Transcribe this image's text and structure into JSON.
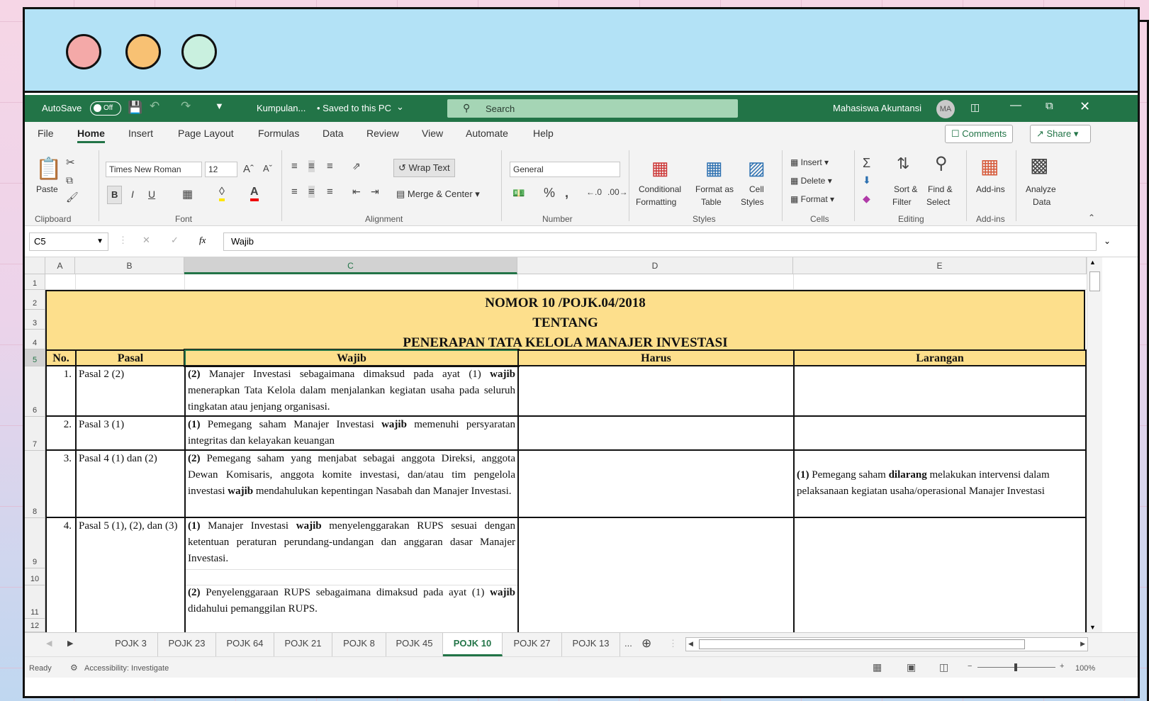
{
  "window": {
    "autosave_label": "AutoSave",
    "autosave_state": "Off",
    "doc_title": "Kumpulan...",
    "save_status": "• Saved to this PC",
    "search_placeholder": "Search",
    "user_name": "Mahasiswa Akuntansi",
    "user_initials": "MA"
  },
  "menu": [
    "File",
    "Home",
    "Insert",
    "Page Layout",
    "Formulas",
    "Data",
    "Review",
    "View",
    "Automate",
    "Help"
  ],
  "menu_active": "Home",
  "comments_label": "Comments",
  "share_label": "Share",
  "ribbon": {
    "paste": "Paste",
    "clipboard": "Clipboard",
    "font_name": "Times New Roman",
    "font_size": "12",
    "font": "Font",
    "wrap_text": "Wrap Text",
    "merge_center": "Merge & Center",
    "alignment": "Alignment",
    "number_format": "General",
    "number": "Number",
    "conditional_1": "Conditional",
    "conditional_2": "Formatting",
    "format_table_1": "Format as",
    "format_table_2": "Table",
    "cell_styles_1": "Cell",
    "cell_styles_2": "Styles",
    "styles": "Styles",
    "insert": "Insert",
    "delete": "Delete",
    "format": "Format",
    "cells": "Cells",
    "sort_1": "Sort &",
    "sort_2": "Filter",
    "find_1": "Find &",
    "find_2": "Select",
    "editing": "Editing",
    "addins": "Add-ins",
    "analyze_1": "Analyze",
    "analyze_2": "Data",
    "addins_group": "Add-ins"
  },
  "formula_bar": {
    "name_box": "C5",
    "fx": "fx",
    "value": "Wajib"
  },
  "columns": [
    "A",
    "B",
    "C",
    "D",
    "E"
  ],
  "rows": [
    "1",
    "2",
    "3",
    "4",
    "5",
    "6",
    "7",
    "8",
    "9",
    "10",
    "11",
    "12"
  ],
  "sheet": {
    "title_line1": "NOMOR 10 /POJK.04/2018",
    "title_line2": "TENTANG",
    "title_line3": "PENERAPAN TATA KELOLA MANAJER INVESTASI",
    "headers": [
      "No.",
      "Pasal",
      "Wajib",
      "Harus",
      "Larangan"
    ],
    "r1": {
      "no": "1.",
      "pasal": "Pasal 2 (2)",
      "wajib_pre": "(2)",
      "wajib_a": " Manajer Investasi sebagaimana dimaksud pada ayat (1) ",
      "wajib_kw": "wajib",
      "wajib_b": " menerapkan Tata Kelola dalam menjalankan kegiatan usaha pada seluruh tingkatan atau jenjang organisasi."
    },
    "r2": {
      "no": "2.",
      "pasal": "Pasal 3 (1)",
      "wajib_pre": "(1)",
      "wajib_a": " Pemegang saham Manajer Investasi ",
      "wajib_kw": "wajib",
      "wajib_b": " memenuhi persyaratan integritas dan kelayakan keuangan"
    },
    "r3": {
      "no": "3.",
      "pasal": "Pasal 4 (1) dan (2)",
      "wajib_pre": "(2)",
      "wajib_a": " Pemegang saham yang menjabat sebagai anggota Direksi, anggota Dewan Komisaris, anggota komite investasi, dan/atau tim pengelola investasi ",
      "wajib_kw": "wajib",
      "wajib_b": " mendahulukan kepentingan Nasabah dan Manajer Investasi.",
      "larangan_pre": "(1)",
      "larangan_a": " Pemegang saham ",
      "larangan_kw": "dilarang",
      "larangan_b": " melakukan intervensi dalam pelaksanaan kegiatan usaha/operasional Manajer Investasi"
    },
    "r4": {
      "no": "4.",
      "pasal": "Pasal 5 (1), (2), dan (3)",
      "wajib1_pre": "(1)",
      "wajib1_a": " Manajer Investasi ",
      "wajib1_kw": "wajib",
      "wajib1_b": " menyelenggarakan RUPS sesuai dengan ketentuan peraturan perundang-undangan dan anggaran dasar Manajer Investasi.",
      "wajib2_pre": "(2)",
      "wajib2_a": " Penyelenggaraan RUPS sebagaimana dimaksud pada ayat (1) ",
      "wajib2_kw": "wajib",
      "wajib2_b": " didahului pemanggilan RUPS."
    }
  },
  "sheet_tabs": [
    "POJK 3",
    "POJK 23",
    "POJK 64",
    "POJK 21",
    "POJK 8",
    "POJK 45",
    "POJK 10",
    "POJK 27",
    "POJK 13"
  ],
  "active_tab": "POJK 10",
  "more_tabs": "...",
  "status": {
    "ready": "Ready",
    "accessibility": "Accessibility: Investigate",
    "zoom": "100%"
  },
  "colors": {
    "excel_green": "#227447",
    "banner_yellow": "#fddf8c",
    "top_blue": "#b3e2f6"
  }
}
